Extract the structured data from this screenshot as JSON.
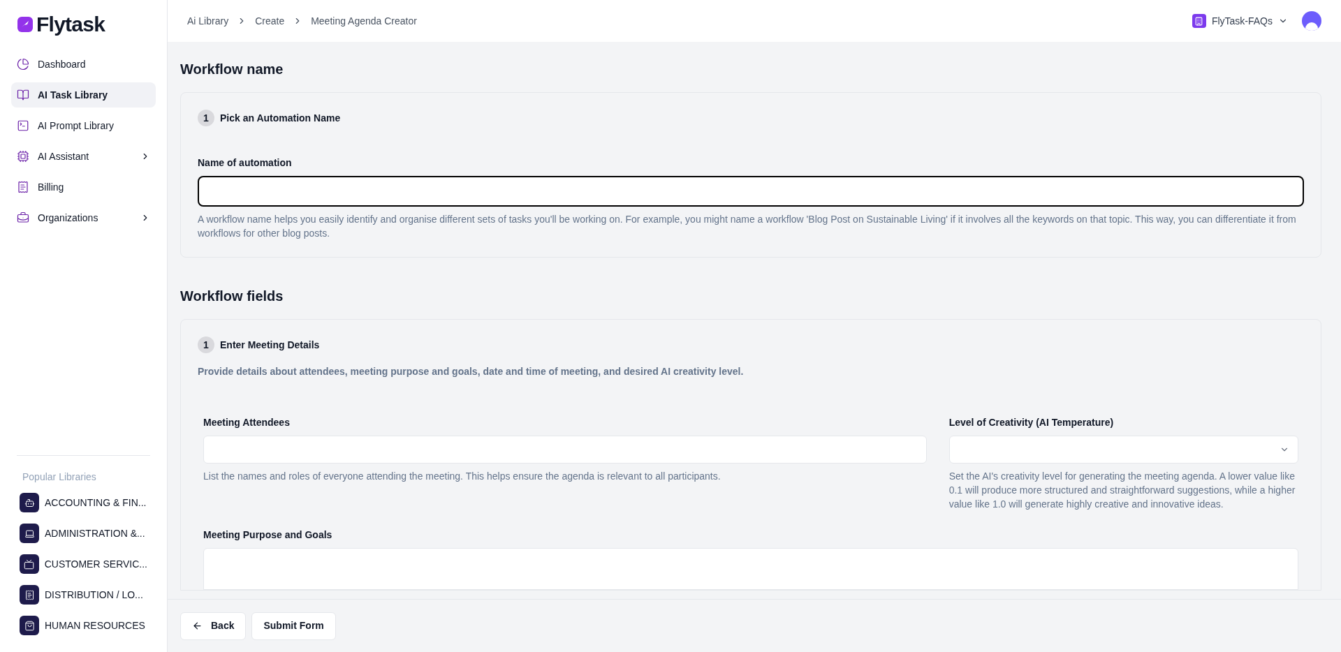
{
  "logo": {
    "text": "Flytask"
  },
  "sidebar": {
    "items": [
      {
        "label": "Dashboard",
        "selected": false,
        "expandable": false
      },
      {
        "label": "AI Task Library",
        "selected": true,
        "expandable": false
      },
      {
        "label": "AI Prompt Library",
        "selected": false,
        "expandable": false
      },
      {
        "label": "AI Assistant",
        "selected": false,
        "expandable": true
      },
      {
        "label": "Billing",
        "selected": false,
        "expandable": false
      },
      {
        "label": "Organizations",
        "selected": false,
        "expandable": true
      }
    ],
    "popular_title": "Popular Libraries",
    "popular": [
      {
        "label": "ACCOUNTING & FIN..."
      },
      {
        "label": "ADMINISTRATION &..."
      },
      {
        "label": "CUSTOMER SERVIC..."
      },
      {
        "label": "DISTRIBUTION / LO..."
      },
      {
        "label": "HUMAN RESOURCES"
      }
    ]
  },
  "breadcrumb": [
    "Ai Library",
    "Create",
    "Meeting Agenda Creator"
  ],
  "workspace": {
    "name": "FlyTask-FAQs"
  },
  "workflow_name": {
    "heading": "Workflow name",
    "step": "1",
    "step_title": "Pick an Automation Name",
    "label": "Name of automation",
    "focused": true,
    "help": "A workflow name helps you easily identify and organise different sets of tasks you'll be working on. For example, you might name a workflow 'Blog Post on Sustainable Living' if it involves all the keywords on that topic. This way, you can differentiate it from workflows for other blog posts."
  },
  "workflow_fields": {
    "heading": "Workflow fields",
    "step": "1",
    "step_title": "Enter Meeting Details",
    "description": "Provide details about attendees, meeting purpose and goals, date and time of meeting, and desired AI creativity level.",
    "attendees": {
      "label": "Meeting Attendees",
      "help": "List the names and roles of everyone attending the meeting. This helps ensure the agenda is relevant to all participants."
    },
    "creativity": {
      "label": "Level of Creativity (AI Temperature)",
      "help": "Set the AI's creativity level for generating the meeting agenda. A lower value like 0.1 will produce more structured and straightforward suggestions, while a higher value like 1.0 will generate highly creative and innovative ideas."
    },
    "purpose": {
      "label": "Meeting Purpose and Goals"
    }
  },
  "footer": {
    "back": "Back",
    "submit": "Submit Form"
  }
}
